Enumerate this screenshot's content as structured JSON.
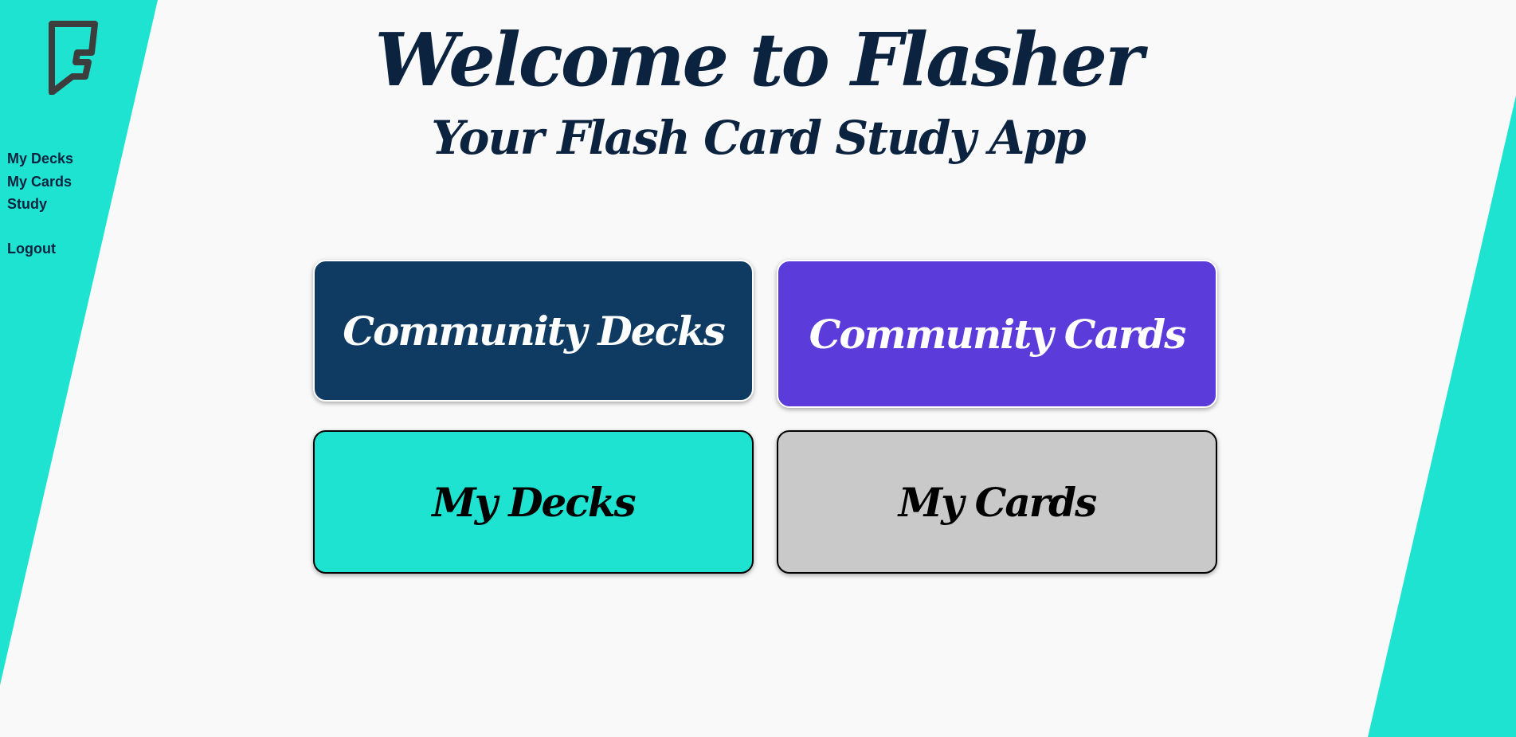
{
  "colors": {
    "background": "#f9f9f9",
    "accent_teal": "#1ee3d1",
    "navy": "#0c2340",
    "community_decks_bg": "#0f3b63",
    "community_cards_bg": "#5b3cdb",
    "my_cards_bg": "#c9c9c9"
  },
  "logo": {
    "icon": "foursquare-f-logo-icon"
  },
  "sidebar": {
    "items": [
      {
        "label": "My Decks"
      },
      {
        "label": "My Cards"
      },
      {
        "label": "Study"
      }
    ],
    "logout_label": "Logout"
  },
  "header": {
    "title": "Welcome to Flasher",
    "subtitle": "Your Flash Card Study App"
  },
  "tiles": [
    {
      "label": "Community Decks"
    },
    {
      "label": "Community Cards"
    },
    {
      "label": "My Decks"
    },
    {
      "label": "My Cards"
    }
  ]
}
